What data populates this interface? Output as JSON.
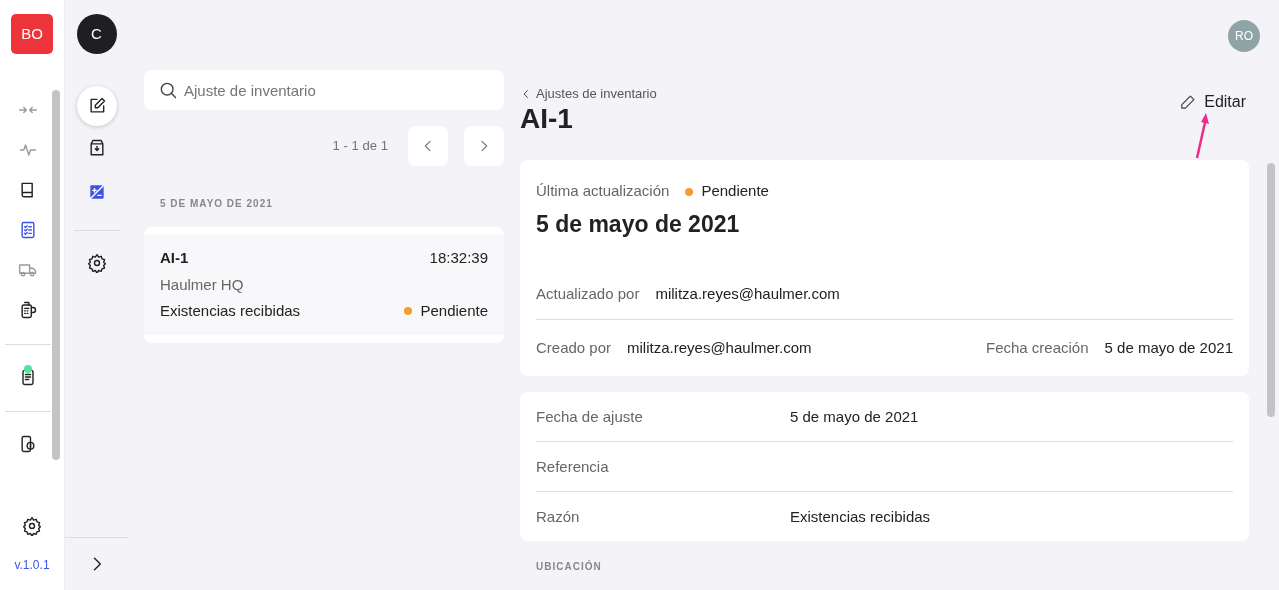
{
  "brand": {
    "badge": "BO"
  },
  "company": {
    "initial": "C"
  },
  "user": {
    "initials": "RO"
  },
  "nav_groups": [
    [
      {
        "kind": "transfer",
        "selected": false,
        "disabled": true
      },
      {
        "kind": "pulse",
        "selected": false,
        "disabled": true
      },
      {
        "kind": "book",
        "selected": false,
        "disabled": false
      },
      {
        "kind": "checklist",
        "selected": true,
        "disabled": false
      },
      {
        "kind": "truck",
        "selected": false,
        "disabled": true
      },
      {
        "kind": "terminal",
        "selected": false,
        "disabled": false
      }
    ],
    [
      {
        "kind": "document",
        "selected": false,
        "disabled": false,
        "notification": true
      }
    ],
    [
      {
        "kind": "money",
        "selected": false,
        "disabled": false
      }
    ]
  ],
  "nav_footer": {
    "version": "v.1.0.1"
  },
  "subnav": [
    {
      "kind": "edit",
      "selected": true
    },
    {
      "kind": "box",
      "selected": false
    },
    {
      "kind": "image",
      "selected": false
    }
  ],
  "list": {
    "search": {
      "placeholder": "Ajuste de inventario"
    },
    "pagination": "1 - 1 de 1",
    "group": "5 DE MAYO DE 2021",
    "items": [
      {
        "id": "AI-1",
        "time": "18:32:39",
        "location": "Haulmer HQ",
        "reason": "Existencias recibidas",
        "status": "Pendiente",
        "color": "#f89c32"
      }
    ]
  },
  "detail": {
    "breadcrumb": "Ajustes de inventario",
    "title": "AI-1",
    "edit": "Editar",
    "summary": {
      "label": "Última actualización",
      "status": "Pendiente",
      "color": "#f89c32",
      "date": "5 de mayo de 2021"
    },
    "updated": {
      "label": "Actualizado por",
      "value": "militza.reyes@haulmer.com"
    },
    "created": [
      {
        "label": "Creado por",
        "value": "militza.reyes@haulmer.com"
      },
      {
        "label": "Fecha creación",
        "value": "5 de mayo de 2021"
      }
    ],
    "fields": [
      {
        "label": "Fecha de ajuste",
        "value": "5 de mayo de 2021"
      },
      {
        "label": "Referencia"
      },
      {
        "label": "Razón",
        "value": "Existencias recibidas"
      }
    ],
    "section": "UBICACIÓN"
  }
}
